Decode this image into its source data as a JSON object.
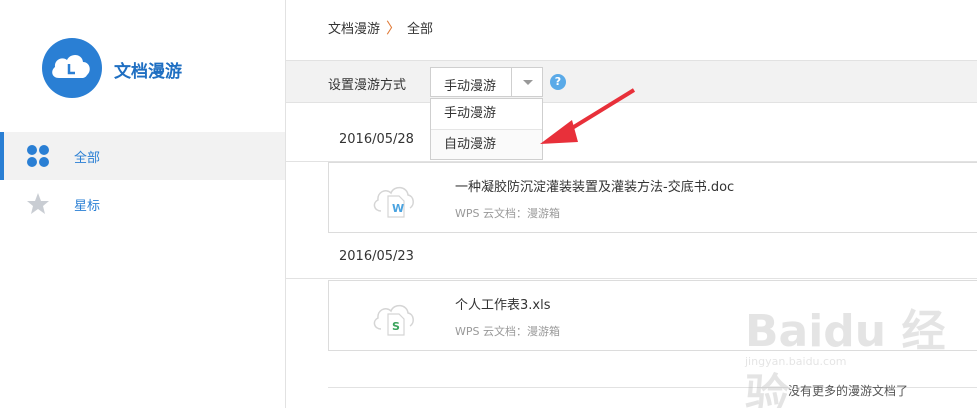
{
  "app": {
    "title": "文档漫游"
  },
  "sidebar": {
    "items": [
      {
        "label": "全部",
        "icon": "grid-icon",
        "active": true
      },
      {
        "label": "星标",
        "icon": "star-icon",
        "active": false
      }
    ]
  },
  "breadcrumb": {
    "parent": "文档漫游",
    "separator": "〉",
    "current": "全部"
  },
  "toolbar": {
    "label": "设置漫游方式",
    "select_value": "手动漫游",
    "help": "?"
  },
  "dropdown": {
    "options": [
      "手动漫游",
      "自动漫游"
    ]
  },
  "groups": [
    {
      "date": "2016/05/28",
      "file": {
        "name": "一种凝胶防沉淀灌装装置及灌装方法-交底书.doc",
        "meta": "WPS 云文档：漫游箱",
        "badge": "W",
        "badge_color": "#4aa3e0"
      }
    },
    {
      "date": "2016/05/23",
      "file": {
        "name": "个人工作表3.xls",
        "meta": "WPS 云文档：漫游箱",
        "badge": "S",
        "badge_color": "#3aa35c"
      }
    }
  ],
  "footer": {
    "no_more": "没有更多的漫游文档了"
  },
  "watermark": {
    "brand": "Baidu 经验",
    "url": "jingyan.baidu.com"
  },
  "colors": {
    "accent": "#2a7fd4",
    "arrow": "#e8303a"
  }
}
